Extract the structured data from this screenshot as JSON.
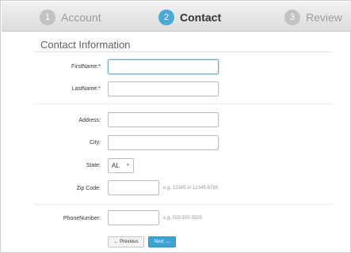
{
  "stepper": {
    "steps": [
      {
        "number": "1",
        "label": "Account"
      },
      {
        "number": "2",
        "label": "Contact"
      },
      {
        "number": "3",
        "label": "Review"
      }
    ]
  },
  "form": {
    "section_title": "Contact Information",
    "first_name": {
      "label": "FirstName:*",
      "value": ""
    },
    "last_name": {
      "label": "LastName:*",
      "value": ""
    },
    "address": {
      "label": "Address:",
      "value": ""
    },
    "city": {
      "label": "City:",
      "value": ""
    },
    "state": {
      "label": "State:",
      "value": "AL"
    },
    "zip": {
      "label": "Zip Code:",
      "value": "",
      "help": "e.g. 12345 or 12345-6789"
    },
    "phone": {
      "label": "PhoneNumber:",
      "value": "",
      "help": "e.g. 555-555-5555"
    }
  },
  "buttons": {
    "previous": "← Previous",
    "next": "Next →"
  }
}
